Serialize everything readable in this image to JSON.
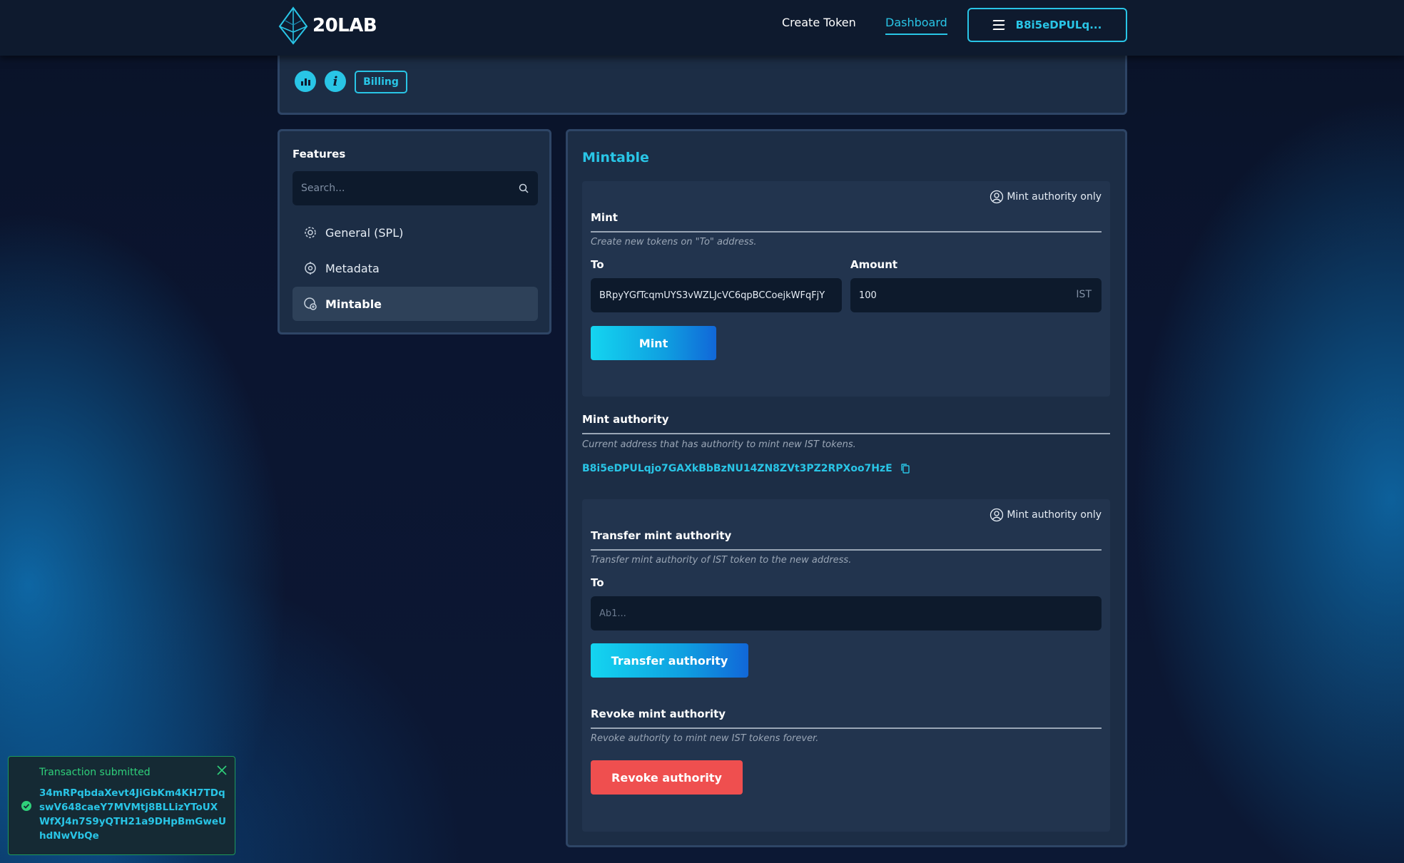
{
  "header": {
    "logo_text": "20LAB",
    "nav": {
      "create_token": "Create Token",
      "dashboard": "Dashboard"
    },
    "wallet_label": "B8i5eDPULq..."
  },
  "top_card": {
    "billing_label": "Billing",
    "info_glyph": "i"
  },
  "features": {
    "title": "Features",
    "search_placeholder": "Search...",
    "items": [
      {
        "label": "General (SPL)",
        "icon": "gear-icon"
      },
      {
        "label": "Metadata",
        "icon": "metadata-icon"
      },
      {
        "label": "Mintable",
        "icon": "mintable-icon",
        "active": true
      }
    ]
  },
  "main": {
    "title": "Mintable",
    "mint": {
      "badge": "Mint authority only",
      "title": "Mint",
      "description": "Create new tokens on \"To\" address.",
      "to_label": "To",
      "to_value": "BRpyYGfTcqmUYS3vWZLJcVC6qpBCCoejkWFqFjY",
      "amount_label": "Amount",
      "amount_value": "100",
      "amount_suffix": "IST",
      "button": "Mint"
    },
    "authority": {
      "title": "Mint authority",
      "description": "Current address that has authority to mint new IST tokens.",
      "address": "B8i5eDPULqjo7GAXkBbBzNU14ZN8ZVt3PZ2RPXoo7HzE"
    },
    "transfer": {
      "badge": "Mint authority only",
      "title": "Transfer mint authority",
      "description": "Transfer mint authority of IST token to the new address.",
      "to_label": "To",
      "to_placeholder": "Ab1...",
      "button": "Transfer authority"
    },
    "revoke": {
      "title": "Revoke mint authority",
      "description": "Revoke authority to mint new IST tokens forever.",
      "button": "Revoke authority"
    }
  },
  "toast": {
    "title": "Transaction submitted",
    "hash": "34mRPqbdaXevt4JiGbKm4KH7TDqswV648caeY7MVMtj8BLLizYToUXWfXJ4n7S9yQTH21a9DHpBmGweUhdNwVbQe"
  },
  "colors": {
    "accent": "#29c5e6",
    "panel": "#1c2d45",
    "danger": "#ef4f4f",
    "success": "#2fd07a"
  }
}
